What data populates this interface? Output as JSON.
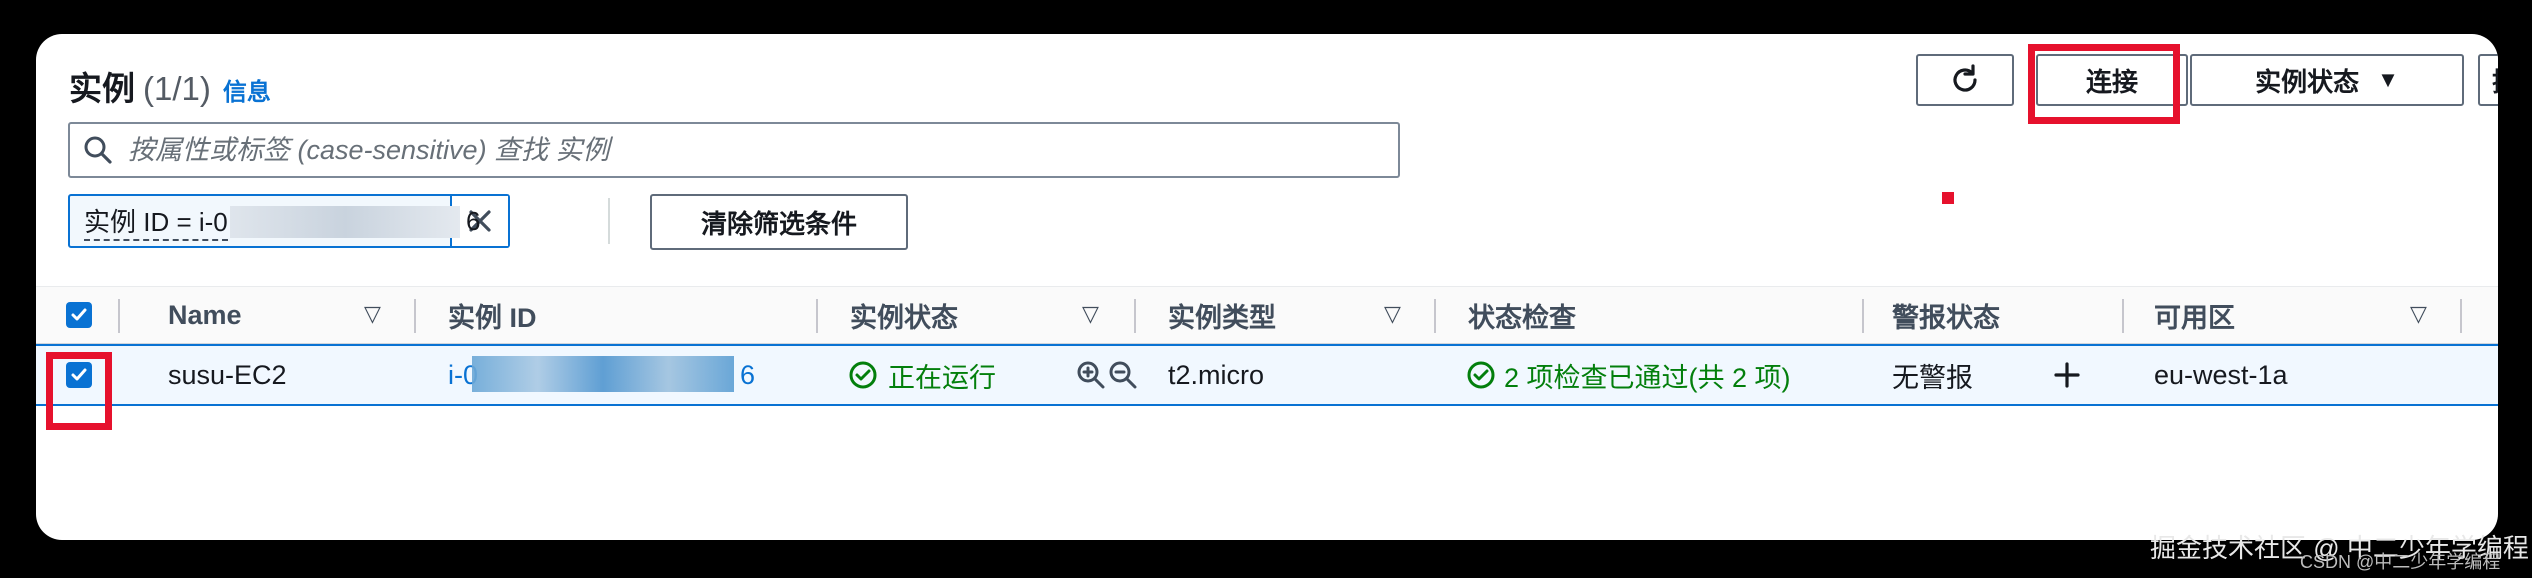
{
  "header": {
    "title": "实例",
    "count": "(1/1)",
    "info_link": "信息",
    "refresh_icon": "refresh-icon",
    "connect_label": "连接",
    "instance_state_label": "实例状态",
    "instance_state_caret": "▼",
    "more_label": "操"
  },
  "search": {
    "placeholder": "按属性或标签 (case-sensitive) 查找 实例",
    "icon": "search-icon"
  },
  "filter": {
    "token_text": "实例 ID = i-0",
    "token_tail": "6",
    "dismiss_icon": "close-icon",
    "clear_label": "清除筛选条件"
  },
  "table": {
    "columns": [
      "Name",
      "实例 ID",
      "实例状态",
      "实例类型",
      "状态检查",
      "警报状态",
      "可用区"
    ],
    "rows": [
      {
        "name": "susu-EC2",
        "instance_id_prefix": "i-0",
        "instance_id_suffix": "6",
        "state": "正在运行",
        "type": "t2.micro",
        "status_check": "2 项检查已通过(共 2 项)",
        "alarm": "无警报",
        "az": "eu-west-1a"
      }
    ]
  },
  "watermark": {
    "text": "掘金技术社区 @ 中二少年学编程",
    "small": "CSDN @中二少年学编程"
  },
  "colors": {
    "accent": "#0972d3",
    "success": "#037f0c",
    "highlight": "#e6112d"
  }
}
